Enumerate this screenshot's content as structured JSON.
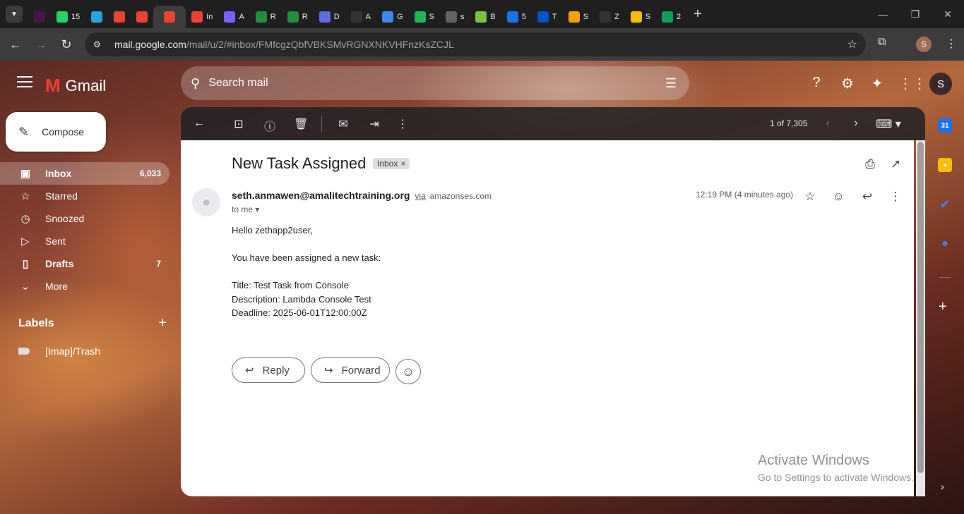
{
  "browser": {
    "tabs": [
      {
        "icon": "slack-icon",
        "label": "",
        "color": "#4a154b"
      },
      {
        "icon": "whatsapp-icon",
        "label": "15",
        "color": "#25d366"
      },
      {
        "icon": "telegram-icon",
        "label": "",
        "color": "#2aa3df"
      },
      {
        "icon": "gmail-icon",
        "label": "",
        "color": "#ea4335"
      },
      {
        "icon": "gmail-icon",
        "label": "",
        "color": "#ea4335"
      },
      {
        "icon": "gmail-icon",
        "label": "",
        "color": "#ea4335",
        "active": true
      },
      {
        "icon": "gmail-icon",
        "label": "In",
        "color": "#ea4335"
      },
      {
        "icon": "cube-icon",
        "label": "A",
        "color": "#7b61ff"
      },
      {
        "icon": "app-icon",
        "label": "R",
        "color": "#1e8e3e"
      },
      {
        "icon": "app-icon",
        "label": "R",
        "color": "#1e8e3e"
      },
      {
        "icon": "eye-icon",
        "label": "D",
        "color": "#5b6ee1"
      },
      {
        "icon": "github-icon",
        "label": "A",
        "color": "#333333"
      },
      {
        "icon": "google-icon",
        "label": "G",
        "color": "#4285f4"
      },
      {
        "icon": "spotify-icon",
        "label": "S",
        "color": "#1db954"
      },
      {
        "icon": "globe-icon",
        "label": "s",
        "color": "#5f6368"
      },
      {
        "icon": "app-icon",
        "label": "B",
        "color": "#7bc043"
      },
      {
        "icon": "app-icon",
        "label": "5",
        "color": "#1a73e8"
      },
      {
        "icon": "app-icon",
        "label": "T",
        "color": "#0052cc"
      },
      {
        "icon": "box-icon",
        "label": "S",
        "color": "#f4a100"
      },
      {
        "icon": "github-icon",
        "label": "Z",
        "color": "#333333"
      },
      {
        "icon": "drive-icon",
        "label": "S",
        "color": "#fbbc04"
      },
      {
        "icon": "sheets-icon",
        "label": "2",
        "color": "#0f9d58"
      }
    ],
    "url_host": "mail.google.com",
    "url_path": "/mail/u/2/#inbox/FMfcgzQbfVBKSMvRGNXNKVHFnzKsZCJL",
    "profile_initial": "S"
  },
  "gmail": {
    "logo_text": "Gmail",
    "search_placeholder": "Search mail",
    "account_initial": "S",
    "compose_label": "Compose",
    "nav": [
      {
        "label": "Inbox",
        "count": "6,033",
        "icon": "inbox-icon",
        "active": true
      },
      {
        "label": "Starred",
        "count": "",
        "icon": "star-icon"
      },
      {
        "label": "Snoozed",
        "count": "",
        "icon": "clock-icon"
      },
      {
        "label": "Sent",
        "count": "",
        "icon": "send-icon"
      },
      {
        "label": "Drafts",
        "count": "7",
        "icon": "draft-icon",
        "bold": true
      },
      {
        "label": "More",
        "count": "",
        "icon": "chevron-down-icon"
      }
    ],
    "labels_heading": "Labels",
    "labels": [
      {
        "label": "[Imap]/Trash"
      }
    ],
    "pager": "1 of 7,305"
  },
  "message": {
    "subject": "New Task Assigned",
    "chip": "Inbox",
    "sender": "seth.anmawen@amalitechtraining.org",
    "via": "via",
    "via_domain": "amazonses.com",
    "to": "to me",
    "time": "12:19 PM (4 minutes ago)",
    "body": {
      "greeting": "Hello zethapp2user,",
      "intro": "You have been assigned a new task:",
      "title": "Title: Test Task from Console",
      "description": "Description: Lambda Console Test",
      "deadline": "Deadline: 2025-06-01T12:00:00Z"
    },
    "reply_label": "Reply",
    "forward_label": "Forward"
  },
  "watermark": {
    "line1": "Activate Windows",
    "line2": "Go to Settings to activate Windows."
  }
}
